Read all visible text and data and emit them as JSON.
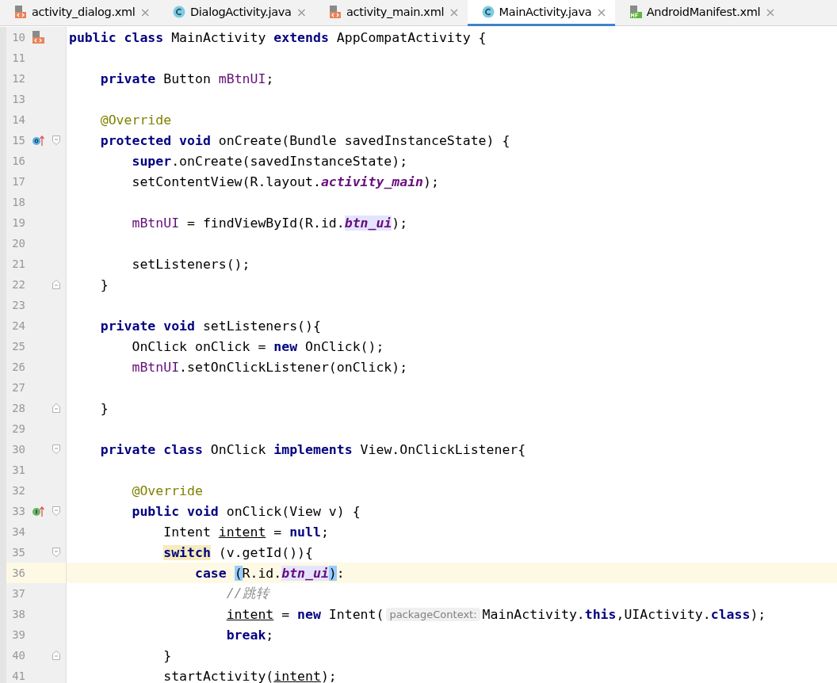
{
  "tabs": [
    {
      "label": "activity_dialog.xml",
      "kind": "xml",
      "selected": false,
      "close": "×"
    },
    {
      "label": "DialogActivity.java",
      "kind": "class",
      "selected": false,
      "close": "×"
    },
    {
      "label": "activity_main.xml",
      "kind": "xml",
      "selected": false,
      "close": "×"
    },
    {
      "label": "MainActivity.java",
      "kind": "class",
      "selected": true,
      "close": "×"
    },
    {
      "label": "AndroidManifest.xml",
      "kind": "manifest",
      "selected": false,
      "close": "×"
    }
  ],
  "editor": {
    "lines": [
      {
        "number": "10",
        "gutter_icon": {
          "kind": "layout"
        },
        "current": false,
        "segments": [
          {
            "kind": "code",
            "tokens": [
              {
                "t": "public class ",
                "kind": "keyword"
              },
              {
                "t": "MainActivity ",
                "kind": "plain"
              },
              {
                "t": "extends ",
                "kind": "keyword"
              },
              {
                "t": "AppCompatActivity {",
                "kind": "plain"
              }
            ]
          }
        ]
      },
      {
        "number": "11",
        "current": false
      },
      {
        "number": "12",
        "current": false,
        "segments": [
          {
            "kind": "code",
            "tokens": [
              {
                "t": "    private ",
                "kind": "keyword"
              },
              {
                "t": "Button ",
                "kind": "plain"
              },
              {
                "t": "mBtnUI",
                "kind": "field"
              },
              {
                "t": ";",
                "kind": "plain"
              }
            ]
          }
        ]
      },
      {
        "number": "13",
        "current": false
      },
      {
        "number": "14",
        "current": false,
        "segments": [
          {
            "kind": "code",
            "tokens": [
              {
                "t": "    @Override",
                "kind": "annotation"
              }
            ]
          }
        ]
      },
      {
        "number": "15",
        "gutter_icon": {
          "kind": "overrides"
        },
        "fold_marker": {
          "kind": "start"
        },
        "current": false,
        "segments": [
          {
            "kind": "code",
            "tokens": [
              {
                "t": "    protected void ",
                "kind": "keyword"
              },
              {
                "t": "onCreate(Bundle savedInstanceState) {",
                "kind": "plain"
              }
            ]
          }
        ]
      },
      {
        "number": "16",
        "current": false,
        "segments": [
          {
            "kind": "code",
            "tokens": [
              {
                "t": "        super",
                "kind": "keyword"
              },
              {
                "t": ".onCreate(savedInstanceState);",
                "kind": "plain"
              }
            ]
          }
        ]
      },
      {
        "number": "17",
        "current": false,
        "segments": [
          {
            "kind": "code",
            "tokens": [
              {
                "t": "        setContentView(R.layout.",
                "kind": "plain"
              },
              {
                "t": "activity_main",
                "kind": "static"
              },
              {
                "t": ");",
                "kind": "plain"
              }
            ]
          }
        ]
      },
      {
        "number": "18",
        "current": false
      },
      {
        "number": "19",
        "current": false,
        "segments": [
          {
            "kind": "code",
            "tokens": [
              {
                "t": "        mBtnUI",
                "kind": "field"
              },
              {
                "t": " = findViewById(R.id.",
                "kind": "plain"
              },
              {
                "t": "btn_ui",
                "kind": "static-usage"
              },
              {
                "t": ");",
                "kind": "plain"
              }
            ]
          }
        ]
      },
      {
        "number": "20",
        "current": false
      },
      {
        "number": "21",
        "current": false,
        "segments": [
          {
            "kind": "code",
            "tokens": [
              {
                "t": "        setListeners();",
                "kind": "plain"
              }
            ]
          }
        ]
      },
      {
        "number": "22",
        "fold_marker": {
          "kind": "end"
        },
        "current": false,
        "segments": [
          {
            "kind": "code",
            "tokens": [
              {
                "t": "    }",
                "kind": "plain"
              }
            ]
          }
        ]
      },
      {
        "number": "23",
        "current": false
      },
      {
        "number": "24",
        "current": false,
        "segments": [
          {
            "kind": "code",
            "tokens": [
              {
                "t": "    private void ",
                "kind": "keyword"
              },
              {
                "t": "setListeners(){",
                "kind": "plain"
              }
            ]
          }
        ]
      },
      {
        "number": "25",
        "current": false,
        "segments": [
          {
            "kind": "code",
            "tokens": [
              {
                "t": "        OnClick onClick = ",
                "kind": "plain"
              },
              {
                "t": "new ",
                "kind": "keyword"
              },
              {
                "t": "OnClick();",
                "kind": "plain"
              }
            ]
          }
        ]
      },
      {
        "number": "26",
        "current": false,
        "segments": [
          {
            "kind": "code",
            "tokens": [
              {
                "t": "        mBtnUI",
                "kind": "field"
              },
              {
                "t": ".setOnClickListener(onClick);",
                "kind": "plain"
              }
            ]
          }
        ]
      },
      {
        "number": "27",
        "current": false
      },
      {
        "number": "28",
        "fold_marker": {
          "kind": "end"
        },
        "current": false,
        "segments": [
          {
            "kind": "code",
            "tokens": [
              {
                "t": "    }",
                "kind": "plain"
              }
            ]
          }
        ]
      },
      {
        "number": "29",
        "current": false
      },
      {
        "number": "30",
        "fold_marker": {
          "kind": "start"
        },
        "current": false,
        "segments": [
          {
            "kind": "code",
            "tokens": [
              {
                "t": "    private class ",
                "kind": "keyword"
              },
              {
                "t": "OnClick ",
                "kind": "plain"
              },
              {
                "t": "implements ",
                "kind": "keyword"
              },
              {
                "t": "View.OnClickListener{",
                "kind": "plain"
              }
            ]
          }
        ]
      },
      {
        "number": "31",
        "current": false
      },
      {
        "number": "32",
        "current": false,
        "segments": [
          {
            "kind": "code",
            "tokens": [
              {
                "t": "        @Override",
                "kind": "annotation"
              }
            ]
          }
        ]
      },
      {
        "number": "33",
        "gutter_icon": {
          "kind": "implements"
        },
        "fold_marker": {
          "kind": "start"
        },
        "current": false,
        "segments": [
          {
            "kind": "code",
            "tokens": [
              {
                "t": "        public void ",
                "kind": "keyword"
              },
              {
                "t": "onClick(View v) {",
                "kind": "plain"
              }
            ]
          }
        ]
      },
      {
        "number": "34",
        "current": false,
        "segments": [
          {
            "kind": "code",
            "tokens": [
              {
                "t": "            Intent ",
                "kind": "plain"
              },
              {
                "t": "intent",
                "kind": "local"
              },
              {
                "t": " = ",
                "kind": "plain"
              },
              {
                "t": "null",
                "kind": "keyword"
              },
              {
                "t": ";",
                "kind": "plain"
              }
            ]
          }
        ]
      },
      {
        "number": "35",
        "fold_marker": {
          "kind": "start"
        },
        "current": false,
        "segments": [
          {
            "kind": "code",
            "tokens": [
              {
                "t": "            switch",
                "kind": "keyword-match"
              },
              {
                "t": " (v.getId()){",
                "kind": "plain"
              }
            ]
          }
        ]
      },
      {
        "number": "36",
        "current": true,
        "segments": [
          {
            "kind": "code",
            "tokens": [
              {
                "t": "                case ",
                "kind": "keyword"
              },
              {
                "t": "(",
                "kind": "brace-match"
              },
              {
                "t": "R.id.",
                "kind": "plain"
              },
              {
                "t": "btn_ui",
                "kind": "static-usage"
              },
              {
                "t": ")",
                "kind": "brace-match"
              },
              {
                "t": ":",
                "kind": "plain"
              }
            ]
          }
        ]
      },
      {
        "number": "37",
        "current": false,
        "segments": [
          {
            "kind": "code",
            "tokens": [
              {
                "t": "                    //跳转",
                "kind": "comment"
              }
            ]
          }
        ]
      },
      {
        "number": "38",
        "current": false,
        "segments": [
          {
            "kind": "code",
            "tokens": [
              {
                "t": "                    intent",
                "kind": "local"
              },
              {
                "t": " = ",
                "kind": "plain"
              },
              {
                "t": "new ",
                "kind": "keyword"
              },
              {
                "t": "Intent(",
                "kind": "plain"
              }
            ]
          },
          {
            "kind": "hint",
            "text": "packageContext:"
          },
          {
            "kind": "code",
            "tokens": [
              {
                "t": "MainActivity.",
                "kind": "plain"
              },
              {
                "t": "this",
                "kind": "keyword"
              },
              {
                "t": ",UIActivity.",
                "kind": "plain"
              },
              {
                "t": "class",
                "kind": "keyword"
              },
              {
                "t": ");",
                "kind": "plain"
              }
            ]
          }
        ]
      },
      {
        "number": "39",
        "current": false,
        "segments": [
          {
            "kind": "code",
            "tokens": [
              {
                "t": "                    break",
                "kind": "keyword"
              },
              {
                "t": ";",
                "kind": "plain"
              }
            ]
          }
        ]
      },
      {
        "number": "40",
        "fold_marker": {
          "kind": "end"
        },
        "current": false,
        "segments": [
          {
            "kind": "code",
            "tokens": [
              {
                "t": "            }",
                "kind": "plain"
              }
            ]
          }
        ]
      },
      {
        "number": "41",
        "current": false,
        "segments": [
          {
            "kind": "code",
            "tokens": [
              {
                "t": "            startActivity(",
                "kind": "plain"
              },
              {
                "t": "intent",
                "kind": "local"
              },
              {
                "t": ");",
                "kind": "plain"
              }
            ]
          }
        ]
      }
    ]
  }
}
